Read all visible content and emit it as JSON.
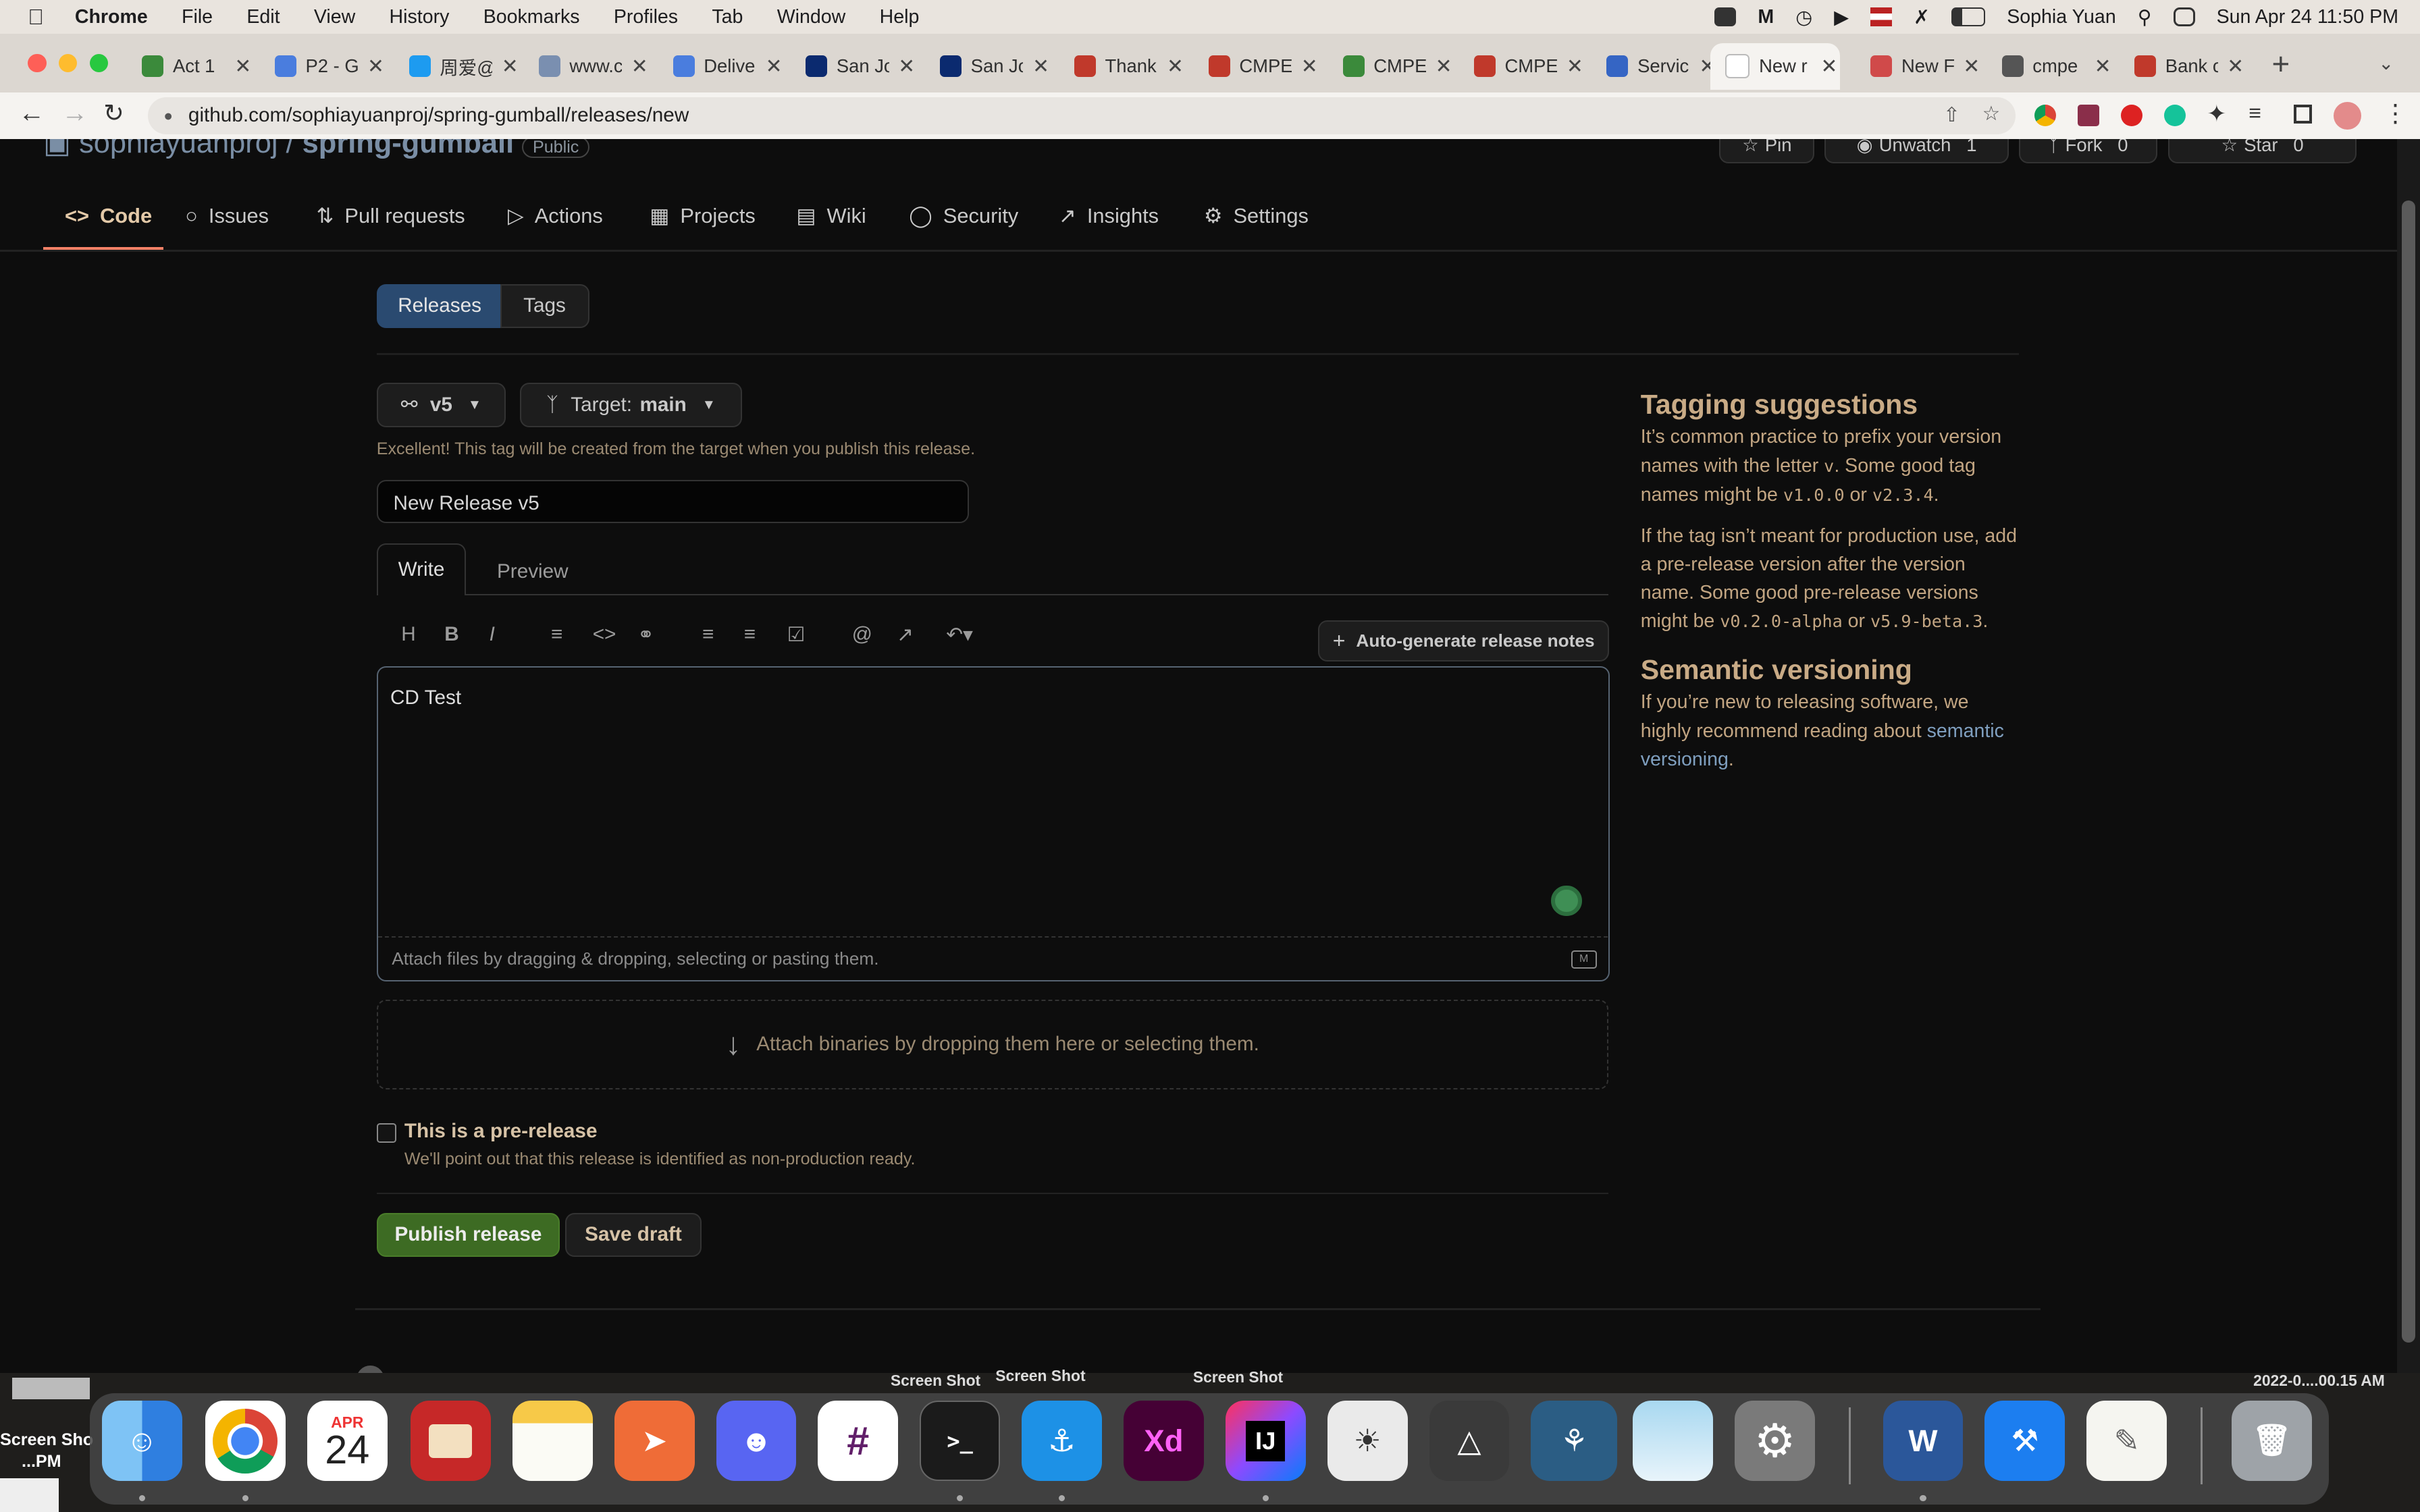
{
  "menubar": {
    "app": "Chrome",
    "items": [
      "File",
      "Edit",
      "View",
      "History",
      "Bookmarks",
      "Profiles",
      "Tab",
      "Window",
      "Help"
    ],
    "user": "Sophia Yuan",
    "datetime": "Sun Apr 24  11:50 PM"
  },
  "tabs": [
    {
      "title": "Act 1",
      "color": "#3b8a3b"
    },
    {
      "title": "P2 - G",
      "color": "#4a7dde"
    },
    {
      "title": "周爱@",
      "color": "#1d9bf0"
    },
    {
      "title": "www.c",
      "color": "#7a8fb0"
    },
    {
      "title": "Delive",
      "color": "#4a7dde"
    },
    {
      "title": "San Jo",
      "color": "#0b2a6f"
    },
    {
      "title": "San Jo",
      "color": "#0b2a6f"
    },
    {
      "title": "Thank",
      "color": "#c0392b"
    },
    {
      "title": "CMPE",
      "color": "#c0392b"
    },
    {
      "title": "CMPE",
      "color": "#3b8a3b"
    },
    {
      "title": "CMPE",
      "color": "#c0392b"
    },
    {
      "title": "Servic",
      "color": "#3565c4"
    },
    {
      "title": "New r",
      "color": "#ffffff"
    },
    {
      "title": "New F",
      "color": "#d04a4a"
    },
    {
      "title": "cmpe",
      "color": "#555555"
    },
    {
      "title": "Bank c",
      "color": "#c0392b"
    }
  ],
  "address": {
    "url": "github.com/sophiayuanproj/spring-gumball/releases/new"
  },
  "repo": {
    "owner": "sophiayuanproj",
    "separator": "/",
    "name": "spring-gumball",
    "visibility": "Public"
  },
  "repo_actions": {
    "pin": "Pin",
    "unwatch": "Unwatch",
    "unwatch_count": "1",
    "fork": "Fork",
    "fork_count": "0",
    "star": "Star",
    "star_count": "0"
  },
  "nav": {
    "code": "Code",
    "issues": "Issues",
    "pulls": "Pull requests",
    "actions": "Actions",
    "projects": "Projects",
    "wiki": "Wiki",
    "security": "Security",
    "insights": "Insights",
    "settings": "Settings"
  },
  "subnav": {
    "releases": "Releases",
    "tags": "Tags"
  },
  "release": {
    "tag": "v5",
    "target_label": "Target:",
    "target_value": "main",
    "tag_hint": "Excellent! This tag will be created from the target when you publish this release.",
    "title_value": "New Release v5",
    "write_tab": "Write",
    "preview_tab": "Preview",
    "auto_generate": "Auto-generate release notes",
    "body_value": "CD Test",
    "attach_files": "Attach files by dragging & dropping, selecting or pasting them.",
    "attach_binaries": "Attach binaries by dropping them here or selecting them.",
    "prerelease_label": "This is a pre-release",
    "prerelease_hint": "We'll point out that this release is identified as non-production ready.",
    "publish": "Publish release",
    "save_draft": "Save draft"
  },
  "sidebar": {
    "h1": "Tagging suggestions",
    "p1a": "It’s common practice to prefix your version names with the letter ",
    "p1_v": "v",
    "p1b": ". Some good tag names might be ",
    "p1_c1": "v1.0.0",
    "p1c": " or ",
    "p1_c2": "v2.3.4",
    "p1d": ".",
    "p2a": "If the tag isn’t meant for production use, add a pre-release version after the version name. Some good pre-release versions might be ",
    "p2_c1": "v0.2.0-alpha",
    "p2b": " or ",
    "p2_c2": "v5.9-beta.3",
    "p2c": ".",
    "h2": "Semantic versioning",
    "p3a": "If you’re new to releasing software, we highly recommend reading about ",
    "p3_link": "semantic versioning",
    "p3b": "."
  },
  "desktop": {
    "shot1": "Screen Shot",
    "shot2": "Screen Shot",
    "shot3": "Screen Shot",
    "left_label1": "Screen Sho",
    "left_label2": "...PM",
    "right_label": "2022-0....00.15 AM"
  },
  "dock": {
    "calendar_month": "APR",
    "calendar_day": "24",
    "intellij": "IJ",
    "xd": "Xd"
  }
}
